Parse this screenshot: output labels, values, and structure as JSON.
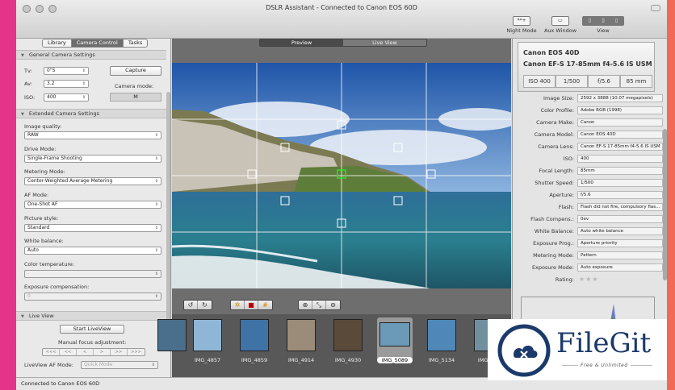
{
  "window": {
    "title": "DSLR Assistant - Connected to Canon EOS 60D"
  },
  "toolbar": {
    "night_mode": "Night Mode",
    "night_icon": "**+",
    "aux_window": "Aux Window",
    "view": "View"
  },
  "sidebar": {
    "tabs": [
      {
        "label": "Library"
      },
      {
        "label": "Camera Control",
        "active": true
      },
      {
        "label": "Tasks"
      }
    ],
    "general": {
      "title": "General Camera Settings",
      "tv_label": "Tv:",
      "tv_value": "0\"5",
      "av_label": "Av:",
      "av_value": "3.2",
      "iso_label": "ISO:",
      "iso_value": "400",
      "capture": "Capture",
      "mode_label": "Camera mode:",
      "mode_value": "M"
    },
    "extended": {
      "title": "Extended Camera Settings",
      "image_quality_label": "Image quality:",
      "image_quality": "RAW",
      "drive_mode_label": "Drive Mode:",
      "drive_mode": "Single-Frame Shooting",
      "metering_label": "Metering Mode:",
      "metering": "Center-Weighted Average Metering",
      "af_label": "AF Mode:",
      "af": "One-Shot AF",
      "picture_style_label": "Picture style:",
      "picture_style": "Standard",
      "white_balance_label": "White balance:",
      "white_balance": "Auto",
      "color_temp_label": "Color temperature:",
      "color_temp": "-",
      "exposure_comp_label": "Exposure compensation:",
      "exposure_comp": "0"
    },
    "liveview": {
      "title": "Live View",
      "start": "Start LiveView",
      "manual_focus": "Manual focus adjustment:",
      "focus_buttons": [
        "<<<",
        "<<",
        "<",
        ">",
        ">>",
        ">>>"
      ],
      "af_mode_label": "LiveView AF Mode:",
      "af_mode": "Quick Mode"
    }
  },
  "center": {
    "tabs": [
      {
        "label": "Preview",
        "active": true
      },
      {
        "label": "Live View"
      }
    ],
    "filmstrip": [
      {
        "name": "IMG_4857",
        "color": "#8fb6d6"
      },
      {
        "name": "IMG_4859",
        "color": "#3f73a6"
      },
      {
        "name": "IMG_4914",
        "color": "#9a8c78"
      },
      {
        "name": "IMG_4930",
        "color": "#5a4a3a"
      },
      {
        "name": "IMG_5089",
        "color": "#6a9ab8",
        "selected": true
      },
      {
        "name": "IMG_5134",
        "color": "#4f88b8"
      },
      {
        "name": "IMG_5...",
        "color": "#7090a0"
      }
    ]
  },
  "status": {
    "text": "Connected to Canon EOS 60D"
  },
  "info": {
    "camera": "Canon EOS 40D",
    "lens": "Canon EF-S 17-85mm f4-5.6 IS USM",
    "chips": [
      "ISO 400",
      "1/500",
      "f/5.6",
      "85 mm"
    ],
    "rows": [
      {
        "k": "Image Size:",
        "v": "2592 x 3888 (10.07 megapixels)"
      },
      {
        "k": "Color Profile:",
        "v": "Adobe RGB (1998)"
      },
      {
        "k": "Camera Make:",
        "v": "Canon"
      },
      {
        "k": "Camera Model:",
        "v": "Canon EOS 40D"
      },
      {
        "k": "Camera Lens:",
        "v": "Canon EF-S 17-85mm f4-5.6 IS USM"
      },
      {
        "k": "ISO:",
        "v": "400"
      },
      {
        "k": "Focal Length:",
        "v": "85mm"
      },
      {
        "k": "Shutter Speed:",
        "v": "1/500"
      },
      {
        "k": "Aperture:",
        "v": "f/5.6"
      },
      {
        "k": "Flash:",
        "v": "Flash did not fire, compulsory flas..."
      },
      {
        "k": "Flash Compens.:",
        "v": "0ev"
      },
      {
        "k": "White Balance:",
        "v": "Auto white balance"
      },
      {
        "k": "Exposure Prog.:",
        "v": "Aperture priority"
      },
      {
        "k": "Metering Mode:",
        "v": "Pattern"
      },
      {
        "k": "Exposure Mode:",
        "v": "Auto exposure"
      },
      {
        "k": "Rating:",
        "v": ""
      }
    ],
    "rating_stars": "★★★"
  },
  "watermark": {
    "brand": "FileGit",
    "tagline": "Free & Unlimited"
  }
}
